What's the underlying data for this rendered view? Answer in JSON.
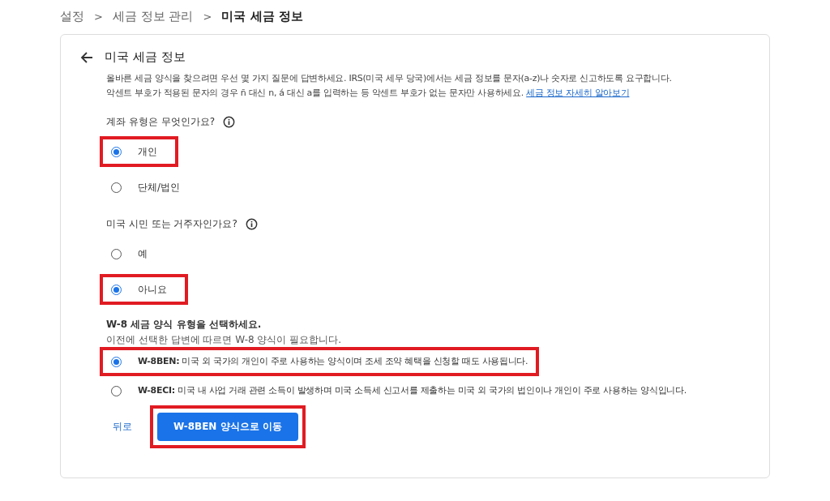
{
  "breadcrumb": [
    {
      "label": "설정",
      "current": false
    },
    {
      "label": "세금 정보 관리",
      "current": false
    },
    {
      "label": "미국 세금 정보",
      "current": true
    }
  ],
  "breadcrumb_separators": [
    ">",
    ">"
  ],
  "card": {
    "title": "미국 세금 정보",
    "intro": [
      "올바른 세금 양식을 찾으려면 우선 몇 가지 질문에 답변하세요. IRS(미국 세무 당국)에서는 세금 정보를 문자(a-z)나 숫자로 신고하도록 요구합니다.",
      "악센트 부호가 적용된 문자의 경우 ñ 대신 n, á 대신 a를 입력하는 등 악센트 부호가 없는 문자만 사용하세요."
    ],
    "learn_more_link": "세금 정보 자세히 알아보기",
    "questions": [
      {
        "label": "계좌 유형은 무엇인가요?",
        "options": [
          {
            "label": "개인",
            "selected": true,
            "highlighted": true
          },
          {
            "label": "단체/법인",
            "selected": false,
            "highlighted": false
          }
        ]
      },
      {
        "label": "미국 시민 또는 거주자인가요?",
        "options": [
          {
            "label": "예",
            "selected": false,
            "highlighted": false
          },
          {
            "label": "아니요",
            "selected": true,
            "highlighted": true
          }
        ]
      }
    ],
    "form_section": {
      "title": "W-8 세금 양식 유형을 선택하세요.",
      "subtitle": "이전에 선택한 답변에 따르면 W-8 양식이 필요합니다.",
      "options": [
        {
          "label": "**W-8BEN:** 미국 외 국가의 개인이 주로 사용하는 양식이며 조세 조약 혜택을 신청할 때도 사용됩니다.",
          "selected": true,
          "highlighted": true
        },
        {
          "label": "**W-8ECI:** 미국 내 사업 거래 관련 소득이 발생하며 미국 소득세 신고서를 제출하는 미국 외 국가의 법인이나 개인이 주로 사용하는 양식입니다.",
          "selected": false,
          "highlighted": false
        }
      ]
    },
    "back_button": "뒤로",
    "primary_button": {
      "label": "W-8BEN 양식으로 이동",
      "highlighted": true
    }
  }
}
